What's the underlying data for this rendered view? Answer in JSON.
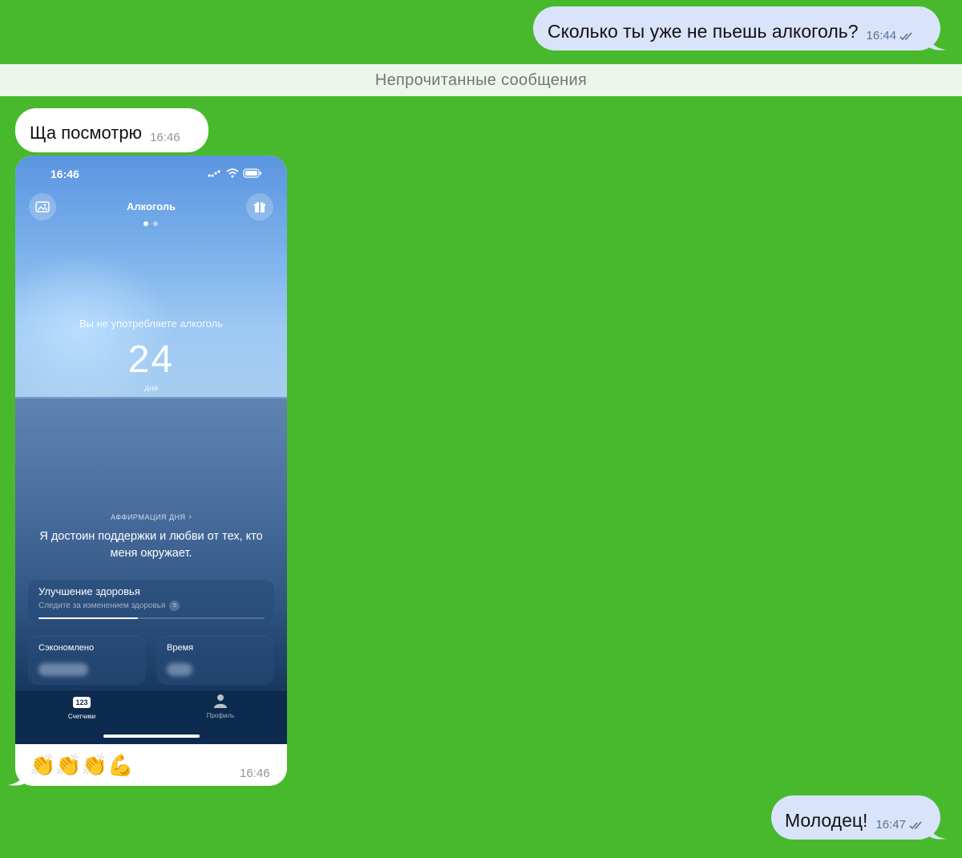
{
  "messages": {
    "out_1": {
      "text": "Сколько ты уже не пьешь алкоголь?",
      "time": "16:44"
    },
    "unread_label": "Непрочитанные сообщения",
    "in_1": {
      "text": "Ща посмотрю",
      "time": "16:46"
    },
    "media": {
      "caption": "👏👏👏💪",
      "time": "16:46"
    },
    "out_2": {
      "text": "Молодец!",
      "time": "16:47"
    }
  },
  "screenshot": {
    "status_time": "16:46",
    "title": "Алкоголь",
    "streak_label": "Вы не употребляете алкоголь",
    "streak_value": "24",
    "streak_unit": "дня",
    "affirmation_label": "АФФИРМАЦИЯ ДНЯ",
    "affirmation_text": "Я достоин поддержки и любви от тех, кто меня окружает.",
    "health_title": "Улучшение здоровья",
    "health_subtitle": "Следите за изменением здоровья",
    "health_badge": "5",
    "health_progress": 0.44,
    "saved_label": "Сэкономлено",
    "time_label": "Время",
    "tab_counters_icon_text": "123",
    "tab_counters": "Счетчики",
    "tab_profile": "Профиль"
  },
  "colors": {
    "chat_background": "#48b92c",
    "outgoing_bubble": "#d9e3fa",
    "incoming_bubble": "#ffffff",
    "check_marks": "#5b7393"
  },
  "icons": {
    "read_status": "double-check-icon",
    "gallery": "image-icon",
    "gift": "gift-icon",
    "profile": "person-icon"
  }
}
